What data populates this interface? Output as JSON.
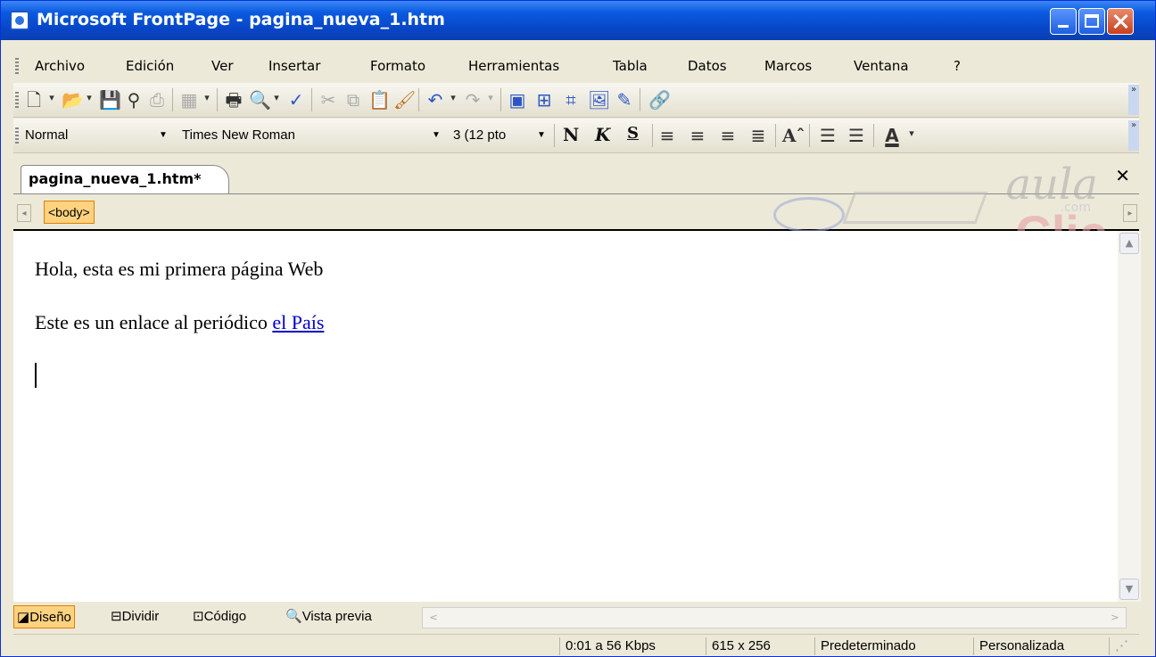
{
  "window": {
    "title": "Microsoft FrontPage - pagina_nueva_1.htm"
  },
  "menu": [
    "Archivo",
    "Edición",
    "Ver",
    "Insertar",
    "Formato",
    "Herramientas",
    "Tabla",
    "Datos",
    "Marcos",
    "Ventana",
    "?"
  ],
  "formatting": {
    "style": "Normal",
    "font": "Times New Roman",
    "size": "3  (12 pto",
    "bold": "N",
    "italic": "K",
    "underline": "S"
  },
  "document_tab": "pagina_nueva_1.htm*",
  "tag_selector": "<body>",
  "watermark": {
    "aula": "aula",
    "com": ".com",
    "clic": "Clic"
  },
  "content": {
    "line1": "Hola, esta es mi primera página Web",
    "line2_prefix": "Este es un enlace al periódico ",
    "link_text": "el País"
  },
  "view_tabs": [
    "Diseño",
    "Dividir",
    "Código",
    "Vista previa"
  ],
  "status": {
    "speed": "0:01 a 56 Kbps",
    "size": "615 x 256",
    "mode1": "Predeterminado",
    "mode2": "Personalizada"
  }
}
